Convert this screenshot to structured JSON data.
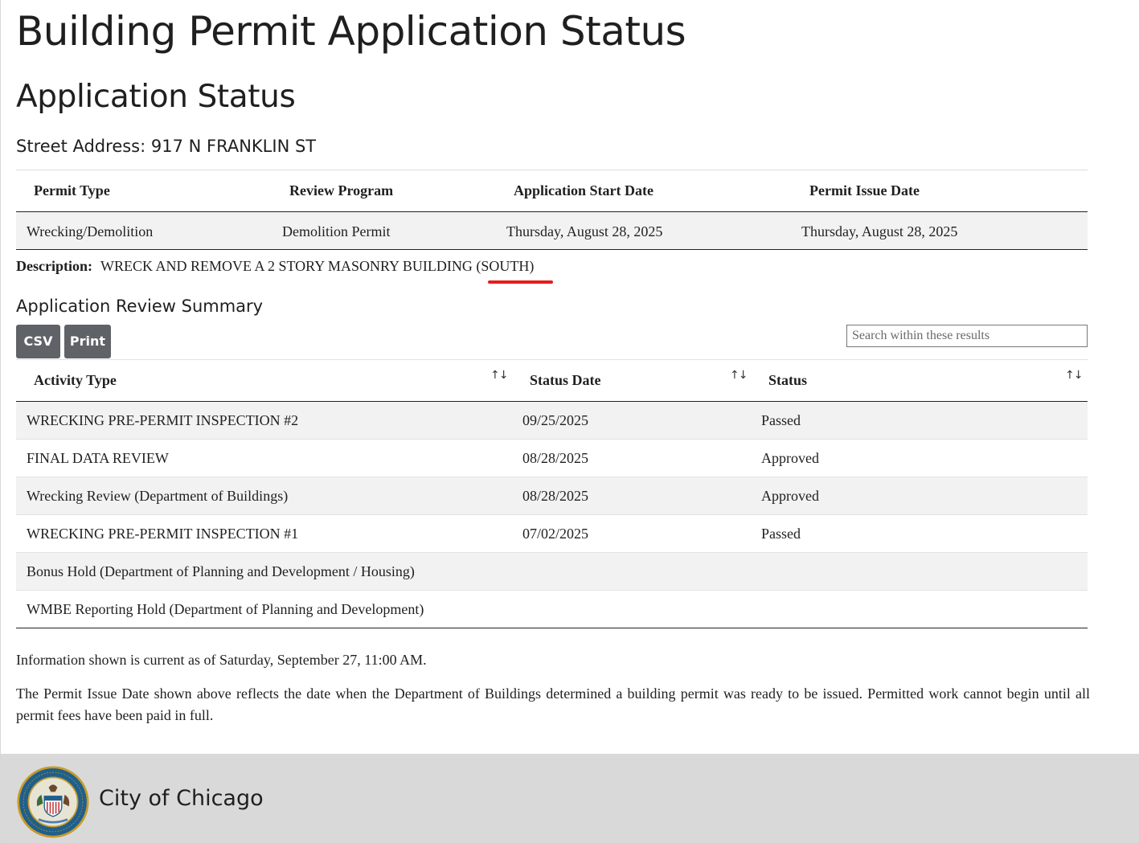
{
  "page": {
    "title": "Building Permit Application Status",
    "section_title": "Application Status",
    "street_address": "Street Address: 917 N FRANKLIN ST"
  },
  "summary_table": {
    "headers": [
      "Permit Type",
      "Review Program",
      "Application Start Date",
      "Permit Issue Date"
    ],
    "row": [
      "Wrecking/Demolition",
      "Demolition Permit",
      "Thursday, August 28, 2025",
      "Thursday, August 28, 2025"
    ]
  },
  "description": {
    "label": "Description:",
    "text": "WRECK AND REMOVE A 2 STORY MASONRY BUILDING (SOUTH)"
  },
  "review_summary": {
    "title": "Application Review Summary",
    "csv_label": "CSV",
    "print_label": "Print",
    "search_placeholder": "Search within these results",
    "headers": [
      "Activity Type",
      "Status Date",
      "Status"
    ],
    "sort_glyph": "↑↓",
    "rows": [
      [
        "WRECKING PRE-PERMIT INSPECTION #2",
        "09/25/2025",
        "Passed"
      ],
      [
        "FINAL DATA REVIEW",
        "08/28/2025",
        "Approved"
      ],
      [
        "Wrecking Review (Department of Buildings)",
        "08/28/2025",
        "Approved"
      ],
      [
        "WRECKING PRE-PERMIT INSPECTION #1",
        "07/02/2025",
        "Passed"
      ],
      [
        "Bonus Hold (Department of Planning and Development / Housing)",
        "",
        ""
      ],
      [
        "WMBE Reporting Hold (Department of Planning and Development)",
        "",
        ""
      ]
    ]
  },
  "notes": {
    "current_as_of": "Information shown is current as of Saturday, September 27, 11:00 AM.",
    "permit_issue_note": "The Permit Issue Date shown above reflects the date when the Department of Buildings determined a building permit was ready to be issued. Permitted work cannot begin until all permit fees have been paid in full."
  },
  "footer": {
    "name": "City of Chicago",
    "seal_text": "CITY OF CHICAGO · INCORPORATED 4th MARCH 1837"
  },
  "colors": {
    "button_bg": "#5f6367",
    "highlight_underline": "#e81b1b",
    "footer_bg": "#d9d9d9",
    "row_stripe": "#f2f2f2"
  }
}
